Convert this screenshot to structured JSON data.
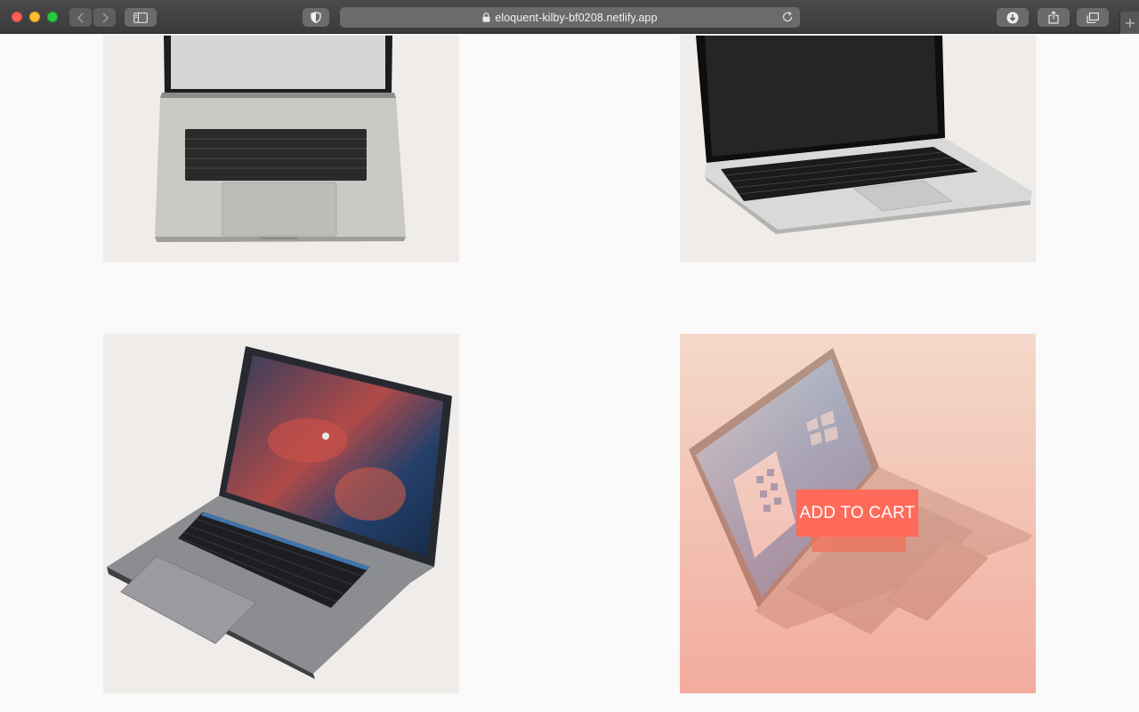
{
  "browser": {
    "url": "eloquent-kilby-bf0208.netlify.app",
    "icons": [
      "back-icon",
      "forward-icon",
      "sidebar-icon",
      "shield-icon",
      "lock-icon",
      "reload-icon",
      "download-icon",
      "share-icon",
      "tabs-icon",
      "plus-icon"
    ]
  },
  "products": [
    {
      "image": "silver-laptop-front"
    },
    {
      "image": "silver-laptop-angled"
    },
    {
      "image": "space-gray-laptop-open"
    },
    {
      "image": "surface-laptop-windows",
      "hover_action": "ADD TO CART"
    }
  ],
  "colors": {
    "accent": "#ff6a5a",
    "card_background": "#f0ecea",
    "page_background": "#fafafa"
  }
}
